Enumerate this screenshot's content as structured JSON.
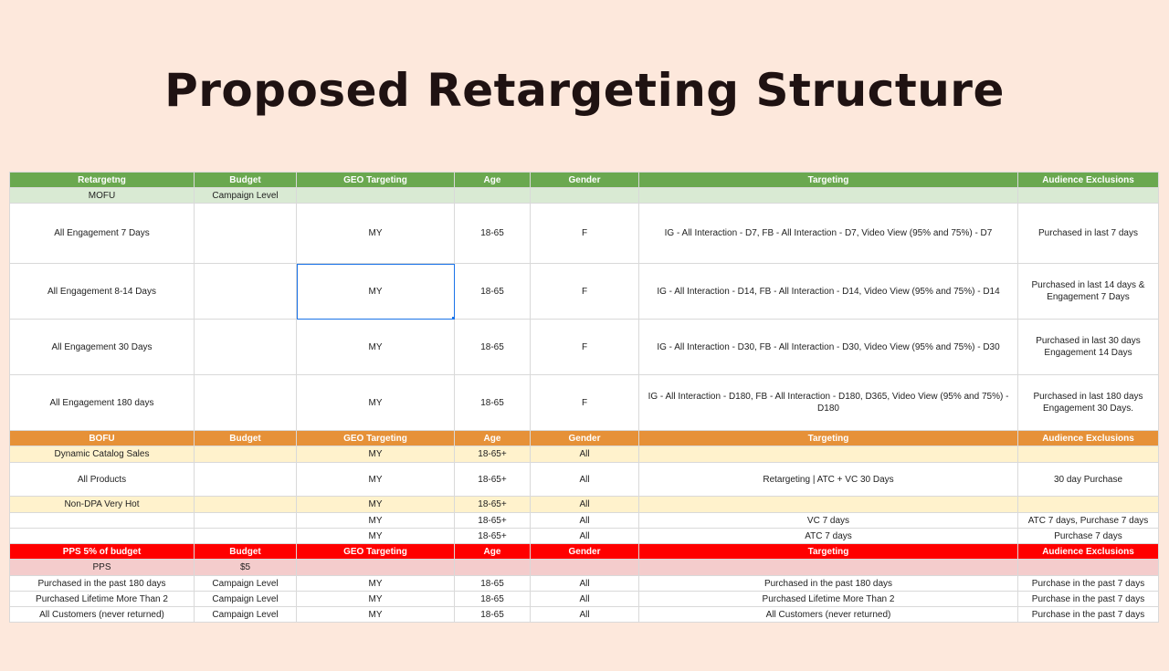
{
  "title": "Proposed Retargeting Structure",
  "mofu": {
    "header": [
      "Retargetng",
      "Budget",
      "GEO Targeting",
      "Age",
      "Gender",
      "Targeting",
      "Audience Exclusions"
    ],
    "section": [
      "MOFU",
      "Campaign Level",
      "",
      "",
      "",
      "",
      ""
    ],
    "rows": [
      [
        "All Engagement 7 Days",
        "",
        "MY",
        "18-65",
        "F",
        "IG - All Interaction - D7, FB - All Interaction - D7,  Video View (95% and 75%) - D7",
        "Purchased in last 7 days"
      ],
      [
        "All Engagement 8-14 Days",
        "",
        "MY",
        "18-65",
        "F",
        "IG - All Interaction - D14, FB - All Interaction - D14,  Video View (95% and 75%) - D14",
        "Purchased in last 14 days & Engagement 7 Days"
      ],
      [
        "All Engagement 30 Days",
        "",
        "MY",
        "18-65",
        "F",
        "IG - All Interaction - D30, FB - All Interaction - D30,  Video View (95% and 75%) - D30",
        "Purchased in last 30 days Engagement 14 Days"
      ],
      [
        "All Engagement 180 days",
        "",
        "MY",
        "18-65",
        "F",
        "IG - All Interaction - D180, FB - All Interaction - D180, D365,  Video View (95% and 75%) - D180",
        "Purchased in last 180 days Engagement 30 Days."
      ]
    ]
  },
  "bofu": {
    "header": [
      "BOFU",
      "Budget",
      "GEO Targeting",
      "Age",
      "Gender",
      "Targeting",
      "Audience Exclusions"
    ],
    "rows": [
      [
        "Dynamic Catalog Sales",
        "",
        "MY",
        "18-65+",
        "All",
        "",
        ""
      ],
      [
        "All Products",
        "",
        "MY",
        "18-65+",
        "All",
        "Retargeting | ATC + VC 30 Days",
        "30 day Purchase"
      ],
      [
        "Non-DPA Very Hot",
        "",
        "MY",
        "18-65+",
        "All",
        "",
        ""
      ],
      [
        "",
        "",
        "MY",
        "18-65+",
        "All",
        "VC 7 days",
        "ATC 7 days, Purchase 7 days"
      ],
      [
        "",
        "",
        "MY",
        "18-65+",
        "All",
        "ATC 7 days",
        "Purchase 7 days"
      ]
    ]
  },
  "pps": {
    "header": [
      "PPS 5% of budget",
      "Budget",
      "GEO Targeting",
      "Age",
      "Gender",
      "Targeting",
      "Audience Exclusions"
    ],
    "section": [
      "PPS",
      "$5",
      "",
      "",
      "",
      "",
      ""
    ],
    "rows": [
      [
        "Purchased in the past 180 days",
        "Campaign Level",
        "MY",
        "18-65",
        "All",
        "Purchased in the past 180 days",
        "Purchase in the past 7 days"
      ],
      [
        "Purchased Lifetime More Than 2",
        "Campaign Level",
        "MY",
        "18-65",
        "All",
        "Purchased Lifetime More Than 2",
        "Purchase in the past 7 days"
      ],
      [
        "All Customers (never returned)",
        "Campaign Level",
        "MY",
        "18-65",
        "All",
        "All Customers (never returned)",
        "Purchase in the past 7 days"
      ]
    ]
  }
}
